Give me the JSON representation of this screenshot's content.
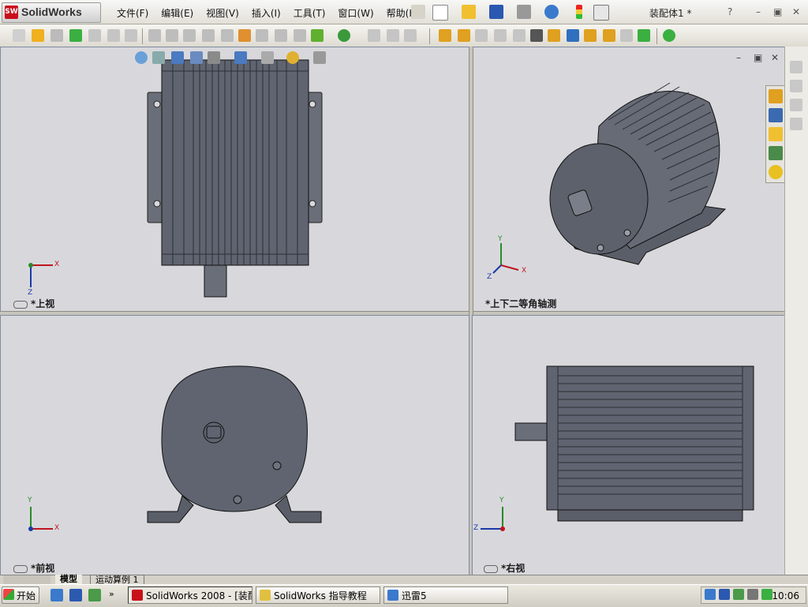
{
  "app": {
    "brand": "SolidWorks",
    "logo_mark": "SW"
  },
  "menu": [
    "文件(F)",
    "编辑(E)",
    "视图(V)",
    "插入(I)",
    "工具(T)",
    "窗口(W)",
    "帮助(H)"
  ],
  "document_title": "装配体1 *",
  "window_controls": {
    "help": "?",
    "minimize": "–",
    "restore": "▣",
    "close": "✕"
  },
  "viewports": {
    "top_left": {
      "label": "*上视"
    },
    "top_right": {
      "label": "*上下二等角轴测"
    },
    "bottom_left": {
      "label": "*前视"
    },
    "bottom_right": {
      "label": "*右视"
    }
  },
  "axis_labels": {
    "x": "X",
    "y": "Y",
    "z": "Z"
  },
  "bottom_tabs": [
    "模型",
    "运动算例 1"
  ],
  "taskbar": {
    "start_label": "开始",
    "items": [
      {
        "label": "SolidWorks 2008 - [装配…",
        "active": true
      },
      {
        "label": "SolidWorks 指导教程",
        "active": false
      },
      {
        "label": "迅雷5",
        "active": false
      }
    ],
    "clock": "10:06"
  },
  "colors": {
    "accent_red": "#c8101a",
    "body_fill": "#5f6470",
    "viewport_bg": "#d8d8dc"
  }
}
